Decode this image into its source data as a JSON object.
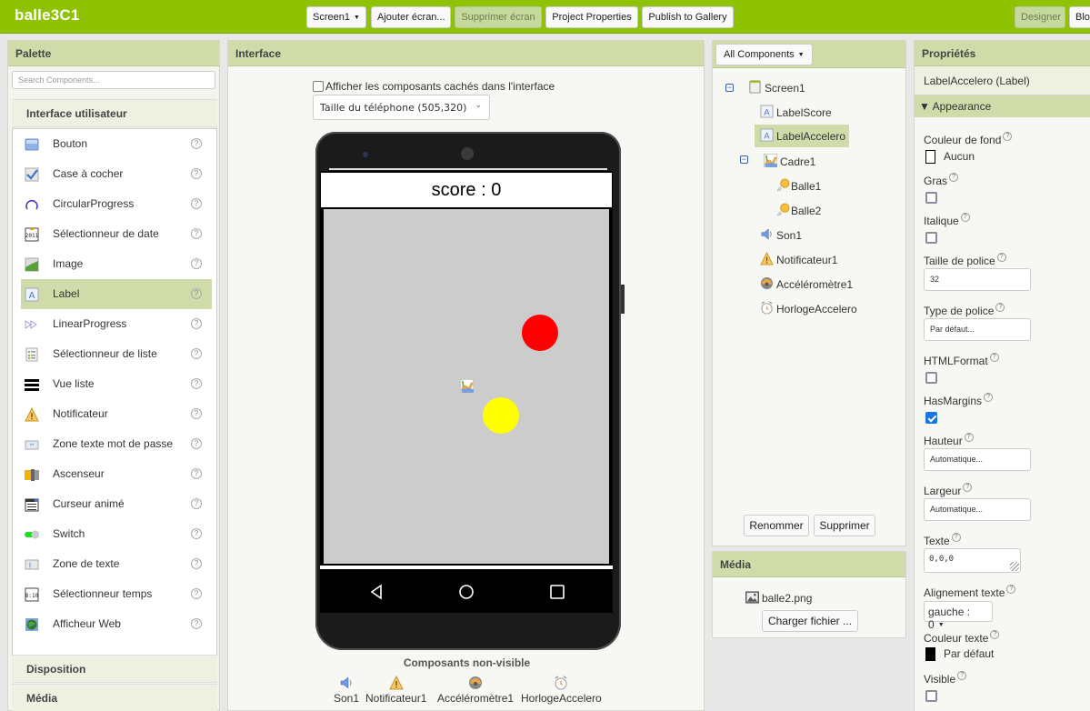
{
  "app": {
    "title": "balle3C1"
  },
  "toolbar": {
    "screen_select": "Screen1",
    "add_screen": "Ajouter écran...",
    "remove_screen": "Supprimer écran",
    "project_properties": "Project Properties",
    "publish": "Publish to Gallery",
    "designer": "Designer",
    "blocks": "Blocks"
  },
  "palette": {
    "title": "Palette",
    "search_placeholder": "Search Components...",
    "sections": {
      "ui": "Interface utilisateur",
      "layout": "Disposition",
      "media": "Média"
    },
    "items": [
      {
        "label": "Bouton",
        "icon": "button-icon"
      },
      {
        "label": "Case à cocher",
        "icon": "checkbox-icon"
      },
      {
        "label": "CircularProgress",
        "icon": "circular-progress-icon"
      },
      {
        "label": "Sélectionneur de date",
        "icon": "date-picker-icon"
      },
      {
        "label": "Image",
        "icon": "image-icon"
      },
      {
        "label": "Label",
        "icon": "label-icon",
        "selected": true
      },
      {
        "label": "LinearProgress",
        "icon": "linear-progress-icon"
      },
      {
        "label": "Sélectionneur de liste",
        "icon": "list-picker-icon"
      },
      {
        "label": "Vue liste",
        "icon": "list-view-icon"
      },
      {
        "label": "Notificateur",
        "icon": "notifier-icon"
      },
      {
        "label": "Zone texte mot de passe",
        "icon": "password-textbox-icon"
      },
      {
        "label": "Ascenseur",
        "icon": "slider-icon"
      },
      {
        "label": "Curseur animé",
        "icon": "spinner-icon"
      },
      {
        "label": "Switch",
        "icon": "switch-icon"
      },
      {
        "label": "Zone de texte",
        "icon": "textbox-icon"
      },
      {
        "label": "Sélectionneur temps",
        "icon": "time-picker-icon"
      },
      {
        "label": "Afficheur Web",
        "icon": "web-viewer-icon"
      }
    ],
    "help_glyph": "?"
  },
  "viewer": {
    "title": "Interface",
    "show_hidden_label": "Afficher les composants cachés dans l'interface",
    "show_hidden_checked": false,
    "phone_size": "Taille du téléphone (505,320)",
    "score_text": "score : 0",
    "balls": [
      {
        "name": "Balle1",
        "color": "#ff0000"
      },
      {
        "name": "Balle2",
        "color": "#ffff00"
      }
    ],
    "nonvisible_title": "Composants non-visible",
    "nonvisible": [
      {
        "label": "Son1",
        "icon": "sound-icon"
      },
      {
        "label": "Notificateur1",
        "icon": "notifier-icon"
      },
      {
        "label": "Accéléromètre1",
        "icon": "accelerometer-icon"
      },
      {
        "label": "HorlogeAccelero",
        "icon": "clock-icon"
      }
    ]
  },
  "components": {
    "filter": "All Components",
    "tree": [
      {
        "label": "Screen1",
        "icon": "screen-icon",
        "level": 0,
        "expanded": true
      },
      {
        "label": "LabelScore",
        "icon": "label-icon",
        "level": 1
      },
      {
        "label": "LabelAccelero",
        "icon": "label-icon",
        "level": 1,
        "selected": true
      },
      {
        "label": "Cadre1",
        "icon": "canvas-icon",
        "level": 1,
        "expanded": true
      },
      {
        "label": "Balle1",
        "icon": "ball-icon",
        "level": 2
      },
      {
        "label": "Balle2",
        "icon": "ball-icon",
        "level": 2
      },
      {
        "label": "Son1",
        "icon": "sound-icon",
        "level": 1
      },
      {
        "label": "Notificateur1",
        "icon": "notifier-icon",
        "level": 1
      },
      {
        "label": "Accéléromètre1",
        "icon": "accelerometer-icon",
        "level": 1
      },
      {
        "label": "HorlogeAccelero",
        "icon": "clock-icon",
        "level": 1
      }
    ],
    "rename": "Renommer",
    "delete": "Supprimer"
  },
  "media": {
    "title": "Média",
    "files": [
      "balle2.png"
    ],
    "upload": "Charger fichier ..."
  },
  "properties": {
    "title": "Propriétés",
    "component": "LabelAccelero (Label)",
    "group": "Appearance",
    "fields": {
      "bg_color": {
        "label": "Couleur de fond",
        "value": "Aucun",
        "swatch": "#ffffff"
      },
      "bold": {
        "label": "Gras",
        "checked": false
      },
      "italic": {
        "label": "Italique",
        "checked": false
      },
      "font_size": {
        "label": "Taille de police",
        "value": "32"
      },
      "font_type": {
        "label": "Type de police",
        "value": "Par défaut..."
      },
      "html_format": {
        "label": "HTMLFormat",
        "checked": false
      },
      "has_margins": {
        "label": "HasMargins",
        "checked": true
      },
      "height": {
        "label": "Hauteur",
        "value": "Automatique..."
      },
      "width": {
        "label": "Largeur",
        "value": "Automatique..."
      },
      "text": {
        "label": "Texte",
        "value": "0,0,0"
      },
      "text_align": {
        "label": "Alignement texte",
        "value": "gauche : 0"
      },
      "text_color": {
        "label": "Couleur texte",
        "value": "Par défaut",
        "swatch": "#000000"
      },
      "visible": {
        "label": "Visible",
        "checked": false
      }
    },
    "help_glyph": "?"
  }
}
